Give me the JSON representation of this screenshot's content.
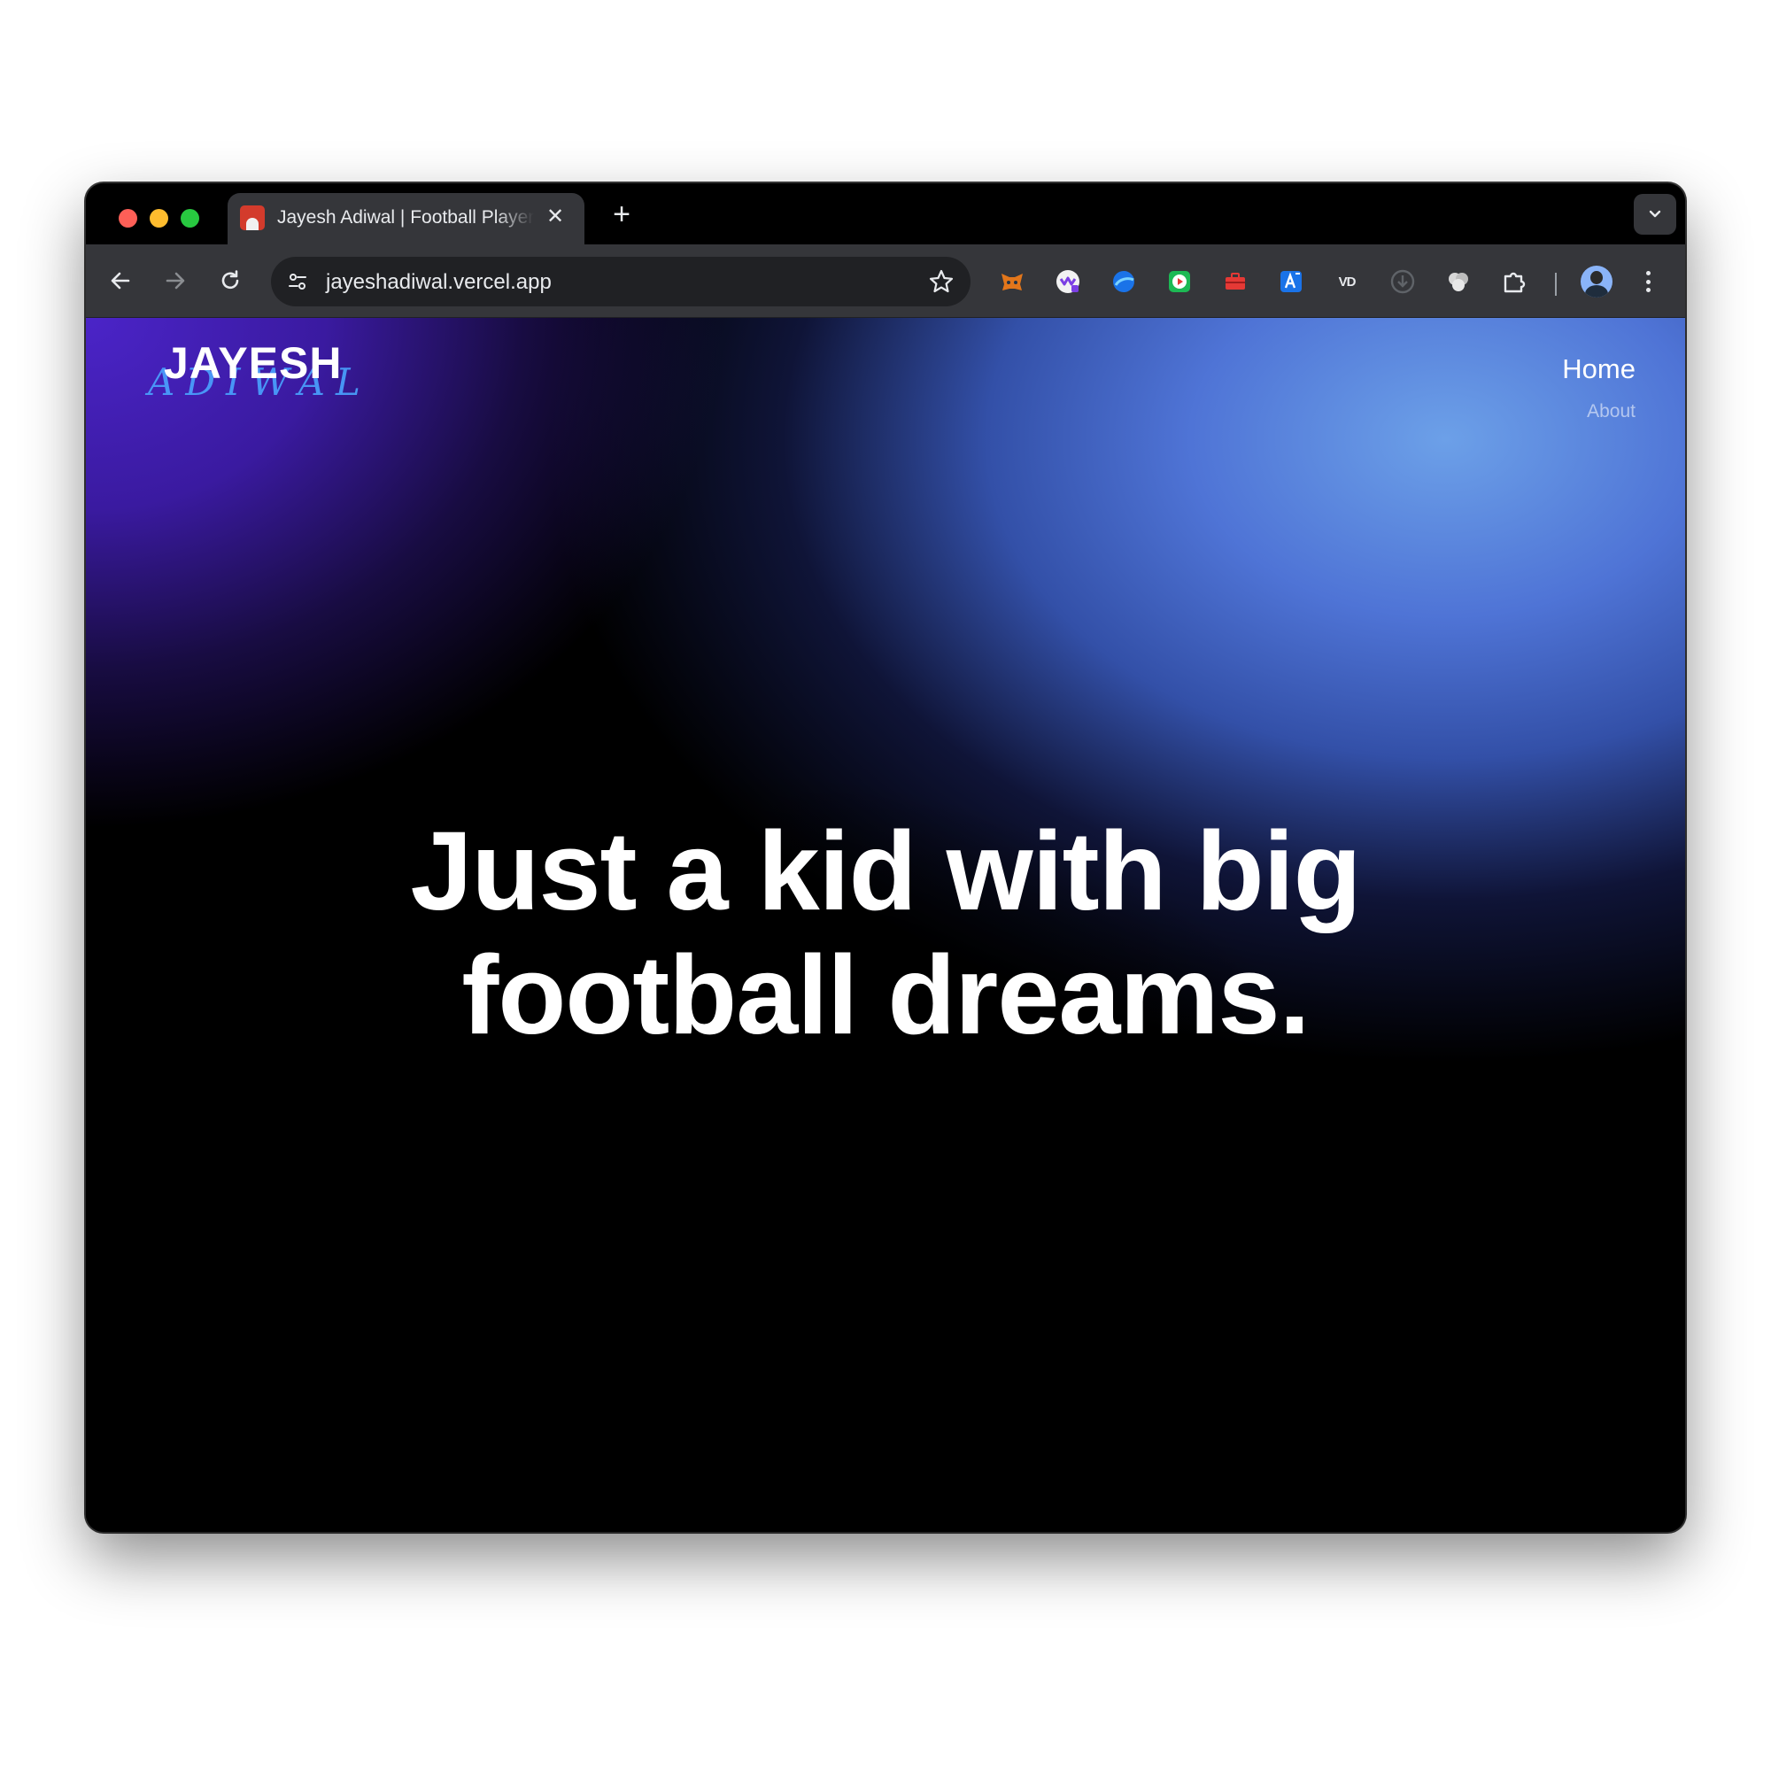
{
  "browser": {
    "tab": {
      "title": "Jayesh Adiwal | Football Player",
      "favicon": "profile-favicon",
      "close_glyph": "✕"
    },
    "new_tab_glyph": "+",
    "address_bar": {
      "url": "jayeshadiwal.vercel.app"
    },
    "extensions": [
      "metamask-icon",
      "wallet-icon",
      "vpn-icon",
      "video-icon",
      "toolbox-icon",
      "translate-icon",
      "vd-icon",
      "download-icon",
      "assistant-icon",
      "puzzle-icon"
    ],
    "extension_text_vd": "VD"
  },
  "page": {
    "logo": {
      "main": "JAYESH",
      "script": "ADIWAL"
    },
    "nav": {
      "home": "Home",
      "about": "About"
    },
    "hero": {
      "headline": "Just a kid with big football dreams."
    },
    "colors": {
      "gradient_purple": "#4b24c8",
      "gradient_blue": "#6ca0e8",
      "background": "#000000"
    }
  }
}
